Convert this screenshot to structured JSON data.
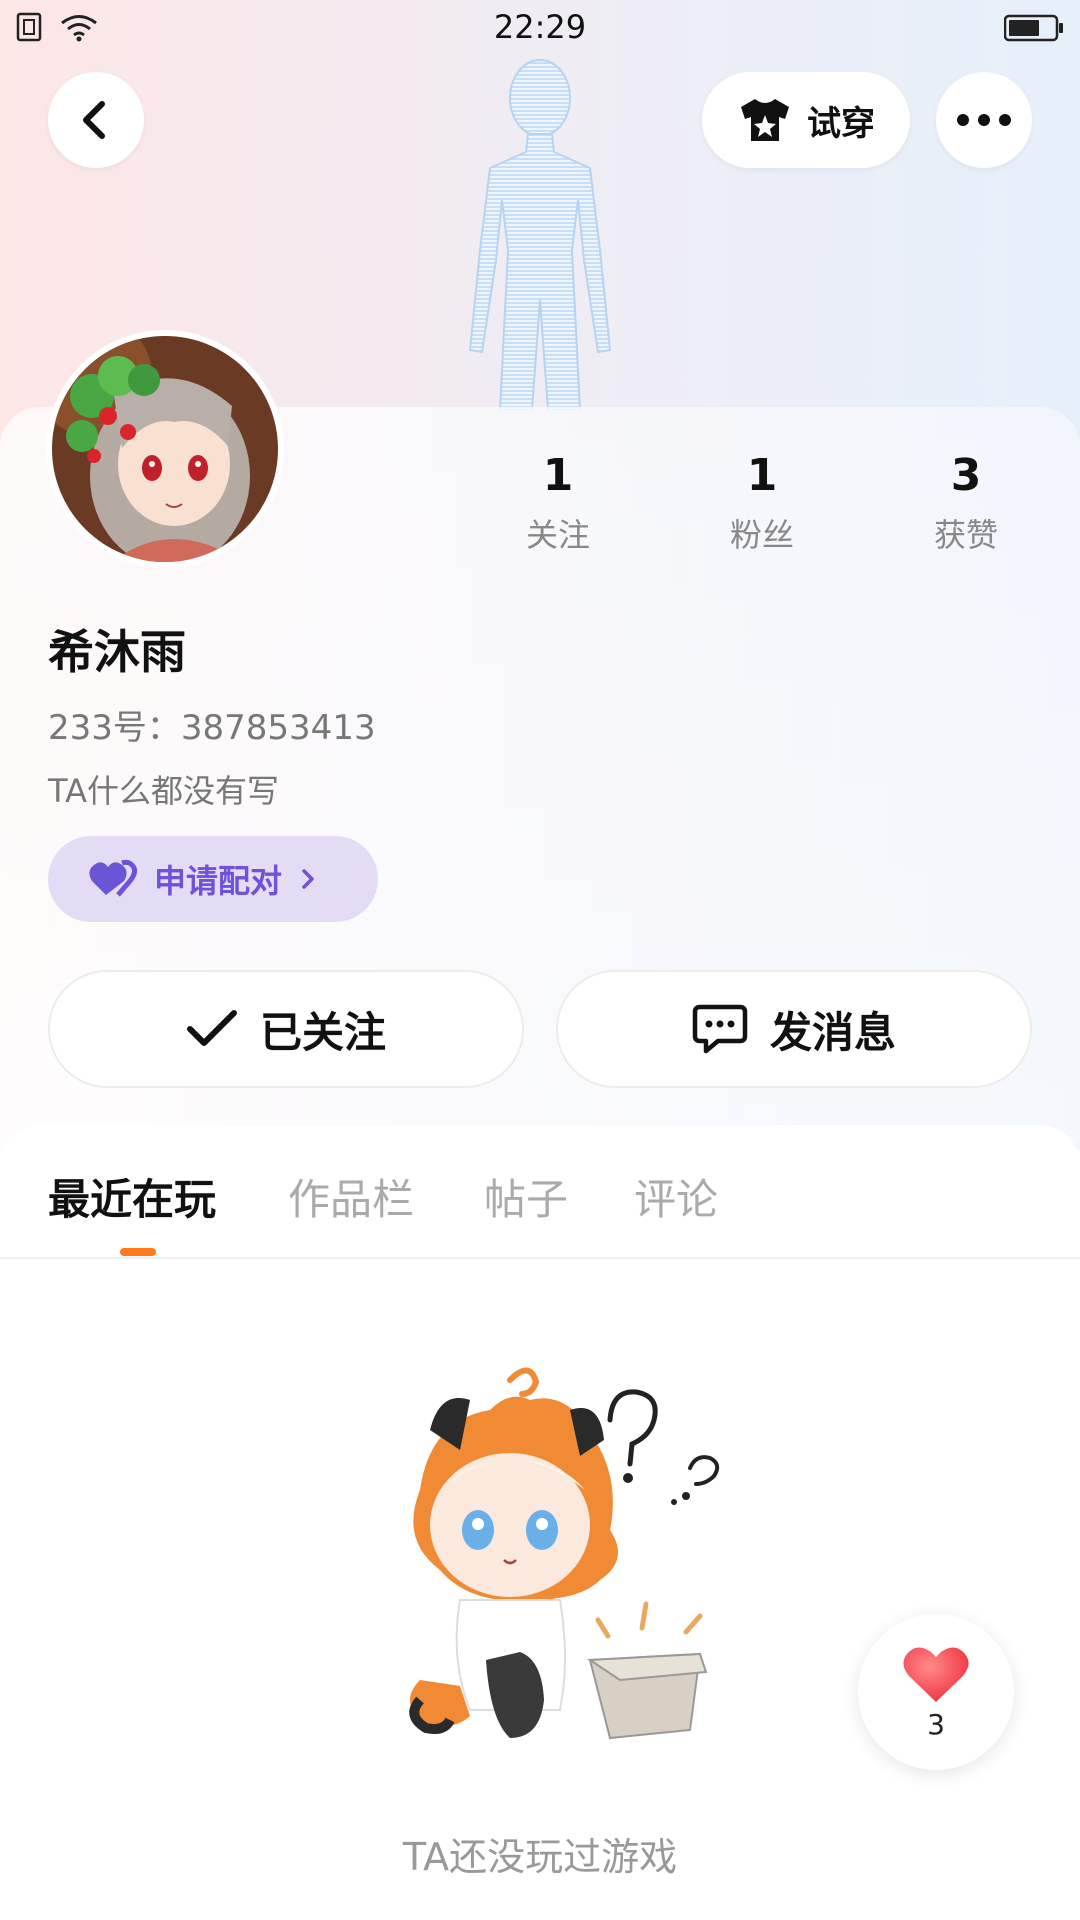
{
  "status_bar": {
    "time": "22:29"
  },
  "header": {
    "try_on_label": "试穿"
  },
  "profile": {
    "name": "希沐雨",
    "uid_text": "233号：387853413",
    "bio": "TA什么都没有写",
    "stats": [
      {
        "value": "1",
        "label": "关注"
      },
      {
        "value": "1",
        "label": "粉丝"
      },
      {
        "value": "3",
        "label": "获赞"
      }
    ],
    "pair_button": "申请配对",
    "followed_button": "已关注",
    "message_button": "发消息"
  },
  "tabs": [
    {
      "label": "最近在玩",
      "active": true
    },
    {
      "label": "作品栏",
      "active": false
    },
    {
      "label": "帖子",
      "active": false
    },
    {
      "label": "评论",
      "active": false
    }
  ],
  "empty_state": {
    "text": "TA还没玩过游戏"
  },
  "like_fab": {
    "count": "3"
  },
  "colors": {
    "accent": "#ff7a1a",
    "pair_purple": "#6a55d6",
    "pair_bg": "#e4dcf5",
    "heart": "#ff4d5a"
  }
}
